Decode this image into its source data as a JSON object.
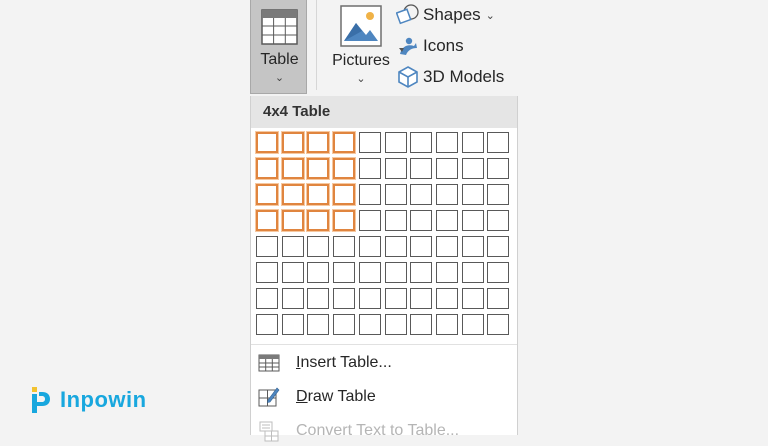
{
  "ribbon": {
    "table_button": {
      "label": "Table",
      "chevron": "⌄",
      "icon": "table-icon"
    },
    "pictures_button": {
      "label": "Pictures",
      "chevron": "⌄",
      "icon": "picture-icon"
    },
    "shapes_button": {
      "label": "Shapes",
      "caret": "⌄",
      "icon": "shapes-icon"
    },
    "icons_button": {
      "label": "Icons",
      "icon": "icons-icon"
    },
    "models_button": {
      "label": "3D Models",
      "icon": "cube-icon"
    }
  },
  "dropdown": {
    "header": "4x4 Table",
    "grid": {
      "columns": 10,
      "rows": 8,
      "selected_columns": 4,
      "selected_rows": 4
    },
    "menu": [
      {
        "label_u": "I",
        "label_rest": "nsert Table...",
        "icon": "insert-table-icon",
        "enabled": true
      },
      {
        "label_u": "D",
        "label_rest": "raw Table",
        "icon": "draw-table-icon",
        "enabled": true
      },
      {
        "label_u": "",
        "label_rest": "Convert Text to Table...",
        "icon": "convert-text-icon",
        "enabled": false
      }
    ]
  },
  "watermark": {
    "text": "Inpowin"
  },
  "colors": {
    "selection_border": "#e0853f",
    "active_button": "#c5c5c5",
    "logo": "#18a7de"
  }
}
